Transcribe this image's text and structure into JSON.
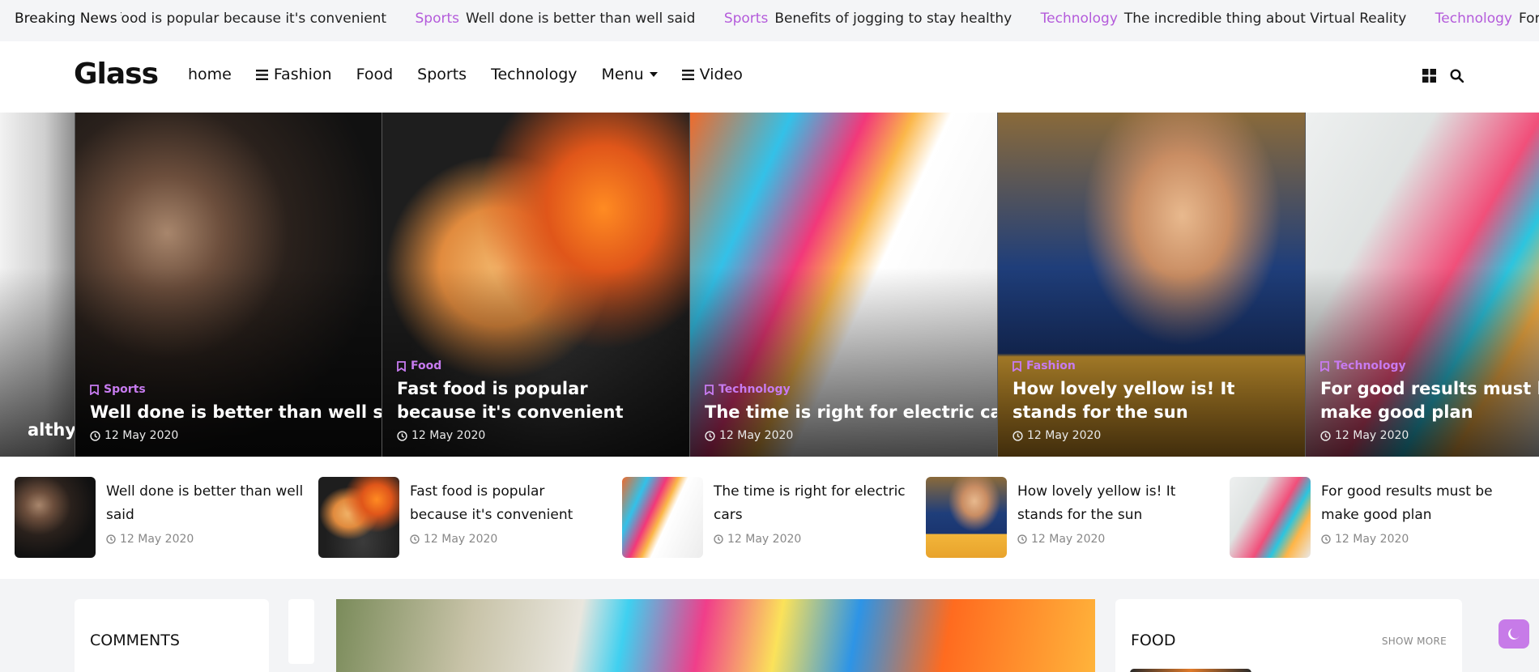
{
  "ticker": {
    "label": "Breaking News",
    "items": [
      {
        "category": "",
        "text": "Fast food is popular because it's convenient"
      },
      {
        "category": "Sports",
        "text": "Well done is better than well said"
      },
      {
        "category": "Sports",
        "text": "Benefits of jogging to stay healthy"
      },
      {
        "category": "Technology",
        "text": "The incredible thing about Virtual Reality"
      },
      {
        "category": "Technology",
        "text": "For good results must be make good plan"
      }
    ]
  },
  "header": {
    "logo": "Glass",
    "nav": [
      {
        "label": "home",
        "icon": ""
      },
      {
        "label": "Fashion",
        "icon": "menu-icon"
      },
      {
        "label": "Food",
        "icon": ""
      },
      {
        "label": "Sports",
        "icon": ""
      },
      {
        "label": "Technology",
        "icon": ""
      },
      {
        "label": "Menu",
        "icon": "caret-down-icon"
      },
      {
        "label": "Video",
        "icon": "menu-icon"
      }
    ],
    "icons": [
      "grid-icon",
      "search-icon"
    ]
  },
  "slider": {
    "prev_title": "Benefits of jogging to stay healthy",
    "slides": [
      {
        "category": "Sports",
        "title": "Well done is better than well said",
        "date": "12 May 2020"
      },
      {
        "category": "Food",
        "title": "Fast food is popular because it's convenient",
        "date": "12 May 2020"
      },
      {
        "category": "Technology",
        "title": "The time is right for electric cars",
        "date": "12 May 2020"
      },
      {
        "category": "Fashion",
        "title": "How lovely yellow is! It stands for the sun",
        "date": "12 May 2020"
      },
      {
        "category": "Technology",
        "title": "For good results must be make good plan",
        "date": "12 May 2020"
      }
    ]
  },
  "thumbs": [
    {
      "title": "Well done is better than well said",
      "date": "12 May 2020"
    },
    {
      "title": "Fast food is popular because it's convenient",
      "date": "12 May 2020"
    },
    {
      "title": "The time is right for electric cars",
      "date": "12 May 2020"
    },
    {
      "title": "How lovely yellow is! It stands for the sun",
      "date": "12 May 2020"
    },
    {
      "title": "For good results must be make good plan",
      "date": "12 May 2020"
    }
  ],
  "bottom": {
    "comments_title": "COMMENTS",
    "food_title": "FOOD",
    "food_more": "SHOW MORE"
  },
  "colors": {
    "accent": "#b45bdb",
    "toggle": "#c77be8"
  }
}
